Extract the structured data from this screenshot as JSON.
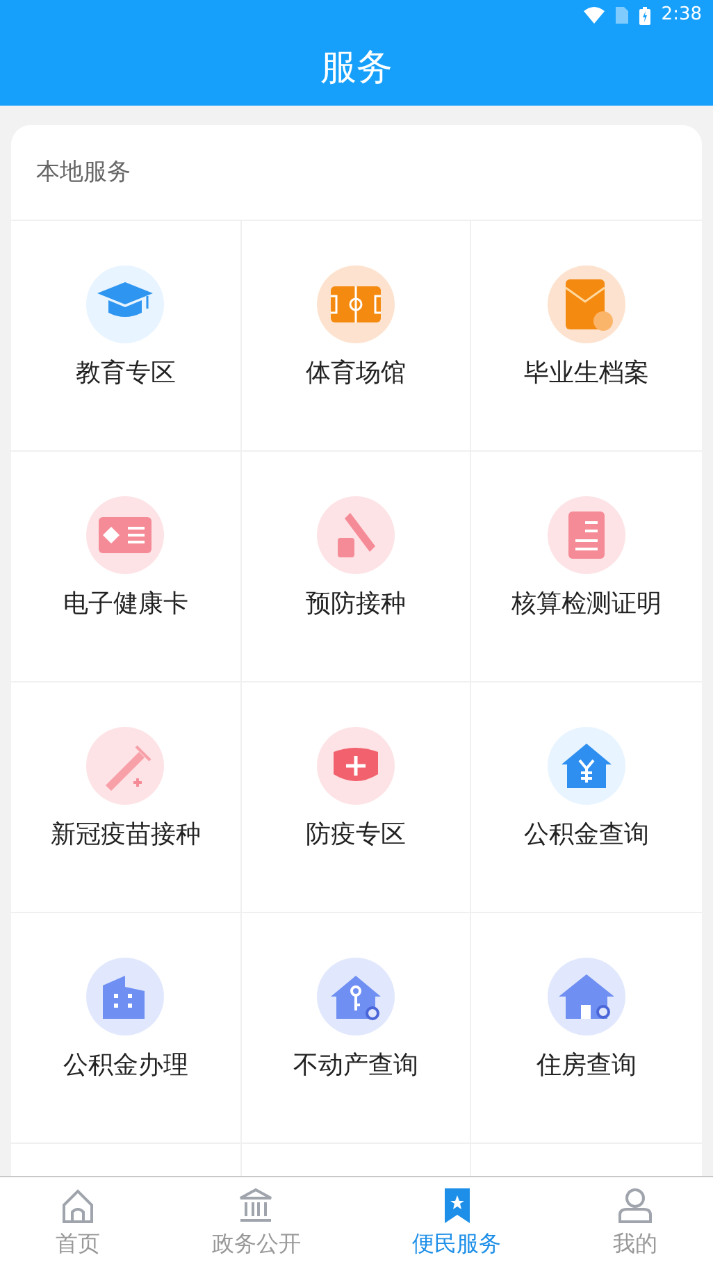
{
  "status_bar": {
    "time": "2:38"
  },
  "header": {
    "title": "服务"
  },
  "section": {
    "title": "本地服务",
    "items": [
      {
        "label": "教育专区"
      },
      {
        "label": "体育场馆"
      },
      {
        "label": "毕业生档案"
      },
      {
        "label": "电子健康卡"
      },
      {
        "label": "预防接种"
      },
      {
        "label": "核算检测证明"
      },
      {
        "label": "新冠疫苗接种"
      },
      {
        "label": "防疫专区"
      },
      {
        "label": "公积金查询"
      },
      {
        "label": "公积金办理"
      },
      {
        "label": "不动产查询"
      },
      {
        "label": "住房查询"
      }
    ]
  },
  "tab_bar": [
    {
      "label": "首页",
      "selected": false
    },
    {
      "label": "政务公开",
      "selected": false
    },
    {
      "label": "便民服务",
      "selected": true
    },
    {
      "label": "我的",
      "selected": false
    }
  ]
}
